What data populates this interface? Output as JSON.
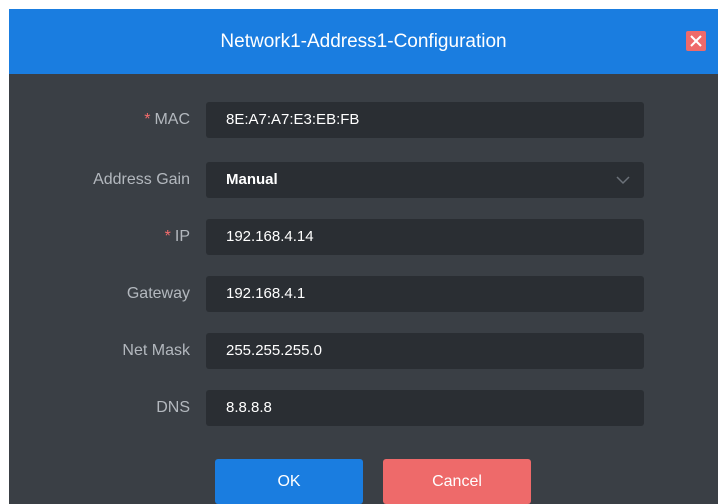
{
  "dialog": {
    "title": "Network1-Address1-Configuration",
    "close_icon": "close-icon",
    "colors": {
      "header": "#1a7de0",
      "body": "#3a3f45",
      "field": "#2a2e33",
      "label": "#b3b8be",
      "required": "#f56c6c",
      "cancel": "#ee6a6a"
    }
  },
  "form": {
    "required_marker": "*",
    "mac": {
      "label": "MAC",
      "value": "8E:A7:A7:E3:EB:FB"
    },
    "address_gain": {
      "label": "Address Gain",
      "value": "Manual"
    },
    "ip": {
      "label": "IP",
      "value": "192.168.4.14"
    },
    "gateway": {
      "label": "Gateway",
      "value": "192.168.4.1"
    },
    "net_mask": {
      "label": "Net Mask",
      "value": "255.255.255.0"
    },
    "dns": {
      "label": "DNS",
      "value": "8.8.8.8"
    }
  },
  "buttons": {
    "ok_label": "OK",
    "cancel_label": "Cancel"
  }
}
